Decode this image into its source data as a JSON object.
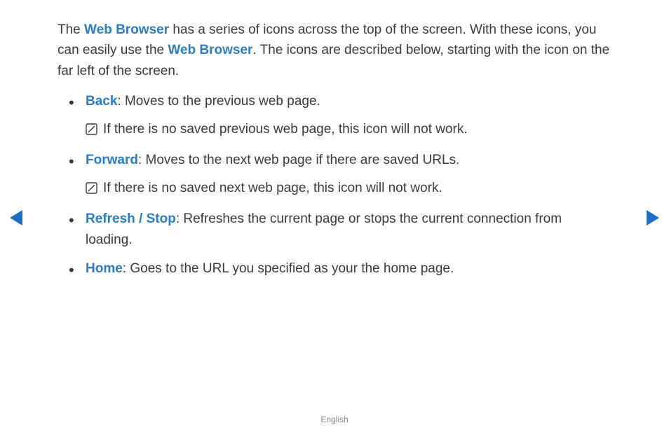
{
  "intro": {
    "p1_a": "The ",
    "term1": "Web Browser",
    "p1_b": " has a series of icons across the top of the screen. With these icons, you can easily use the ",
    "term2": "Web Browser",
    "p1_c": ". The icons are described below, starting with the icon on the far left of the screen."
  },
  "items": [
    {
      "label": "Back",
      "desc": ": Moves to the previous web page.",
      "note": "If there is no saved previous web page, this icon will not work."
    },
    {
      "label": "Forward",
      "desc": ": Moves to the next web page if there are saved URLs.",
      "note": "If there is no saved next web page, this icon will not work."
    },
    {
      "label": "Refresh / Stop",
      "desc": ": Refreshes the current page or stops the current connection from loading.",
      "note": null
    },
    {
      "label": "Home",
      "desc": ": Goes to the URL you specified as your the home page.",
      "note": null
    }
  ],
  "footer": "English"
}
